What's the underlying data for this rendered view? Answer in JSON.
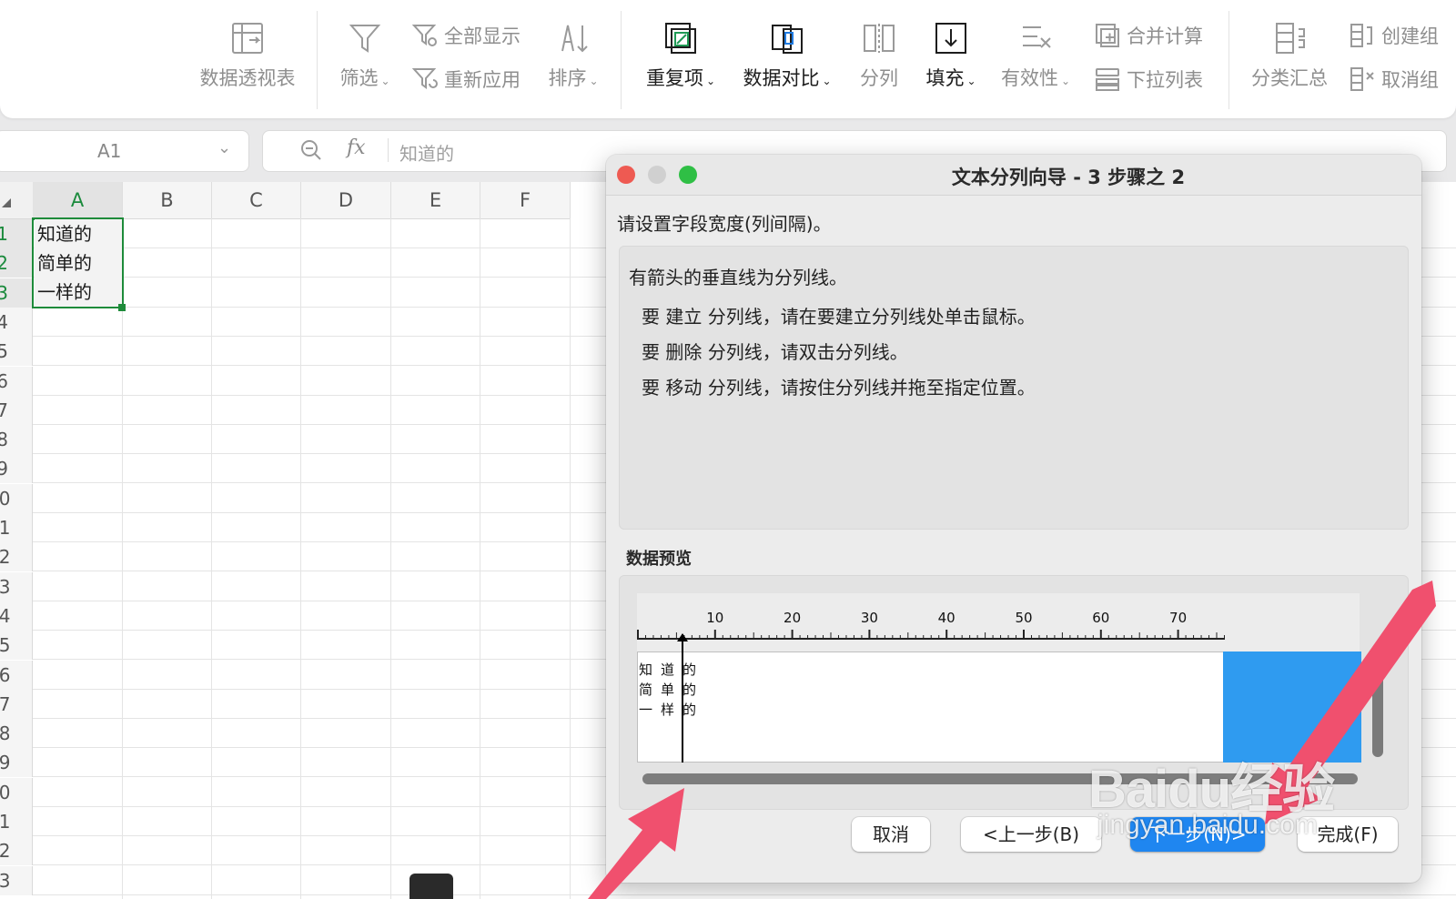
{
  "ribbon": {
    "pivot": "数据透视表",
    "filter": "筛选",
    "show_all": "全部显示",
    "reapply": "重新应用",
    "sort": "排序",
    "duplicates": "重复项",
    "compare": "数据对比",
    "split": "分列",
    "fill": "填充",
    "validity": "有效性",
    "consolidate": "合并计算",
    "dropdown_list": "下拉列表",
    "subtotal": "分类汇总",
    "create_group": "创建组",
    "ungroup": "取消组",
    "caret": "⌄"
  },
  "formula_bar": {
    "name_box": "A1",
    "fx": "fx",
    "content": "知道的"
  },
  "sheet": {
    "columns": [
      "A",
      "B",
      "C",
      "D",
      "E",
      "F"
    ],
    "rows": [
      "1",
      "2",
      "3",
      "4",
      "5",
      "6",
      "7",
      "8",
      "9",
      "10",
      "11",
      "12",
      "13",
      "14",
      "15",
      "16",
      "17",
      "18",
      "19",
      "20",
      "21",
      "22",
      "23"
    ],
    "cells": [
      "知道的",
      "简单的",
      "一样的"
    ]
  },
  "dialog": {
    "title": "文本分列向导 - 3 步骤之 2",
    "intro": "请设置字段宽度(列间隔)。",
    "info": [
      "有箭头的垂直线为分列线。",
      "要 建立 分列线，请在要建立分列线处单击鼠标。",
      "要 删除 分列线，请双击分列线。",
      "要 移动 分列线，请按住分列线并拖至指定位置。"
    ],
    "preview_label": "数据预览",
    "ruler_labels": [
      "10",
      "20",
      "30",
      "40",
      "50",
      "60",
      "70"
    ],
    "preview_rows": [
      [
        "知",
        "道",
        "的"
      ],
      [
        "简",
        "单",
        "的"
      ],
      [
        "一",
        "样",
        "的"
      ]
    ],
    "buttons": {
      "cancel": "取消",
      "back": "<上一步(B)",
      "next": "下一步(N)>",
      "finish": "完成(F)"
    }
  },
  "watermark": {
    "brand": "Baidu经验",
    "url": "jingyan.baidu.com"
  },
  "colors": {
    "accent_green": "#1e8b3a",
    "arrow_red": "#f0506e",
    "primary_blue": "#1f86f0"
  }
}
